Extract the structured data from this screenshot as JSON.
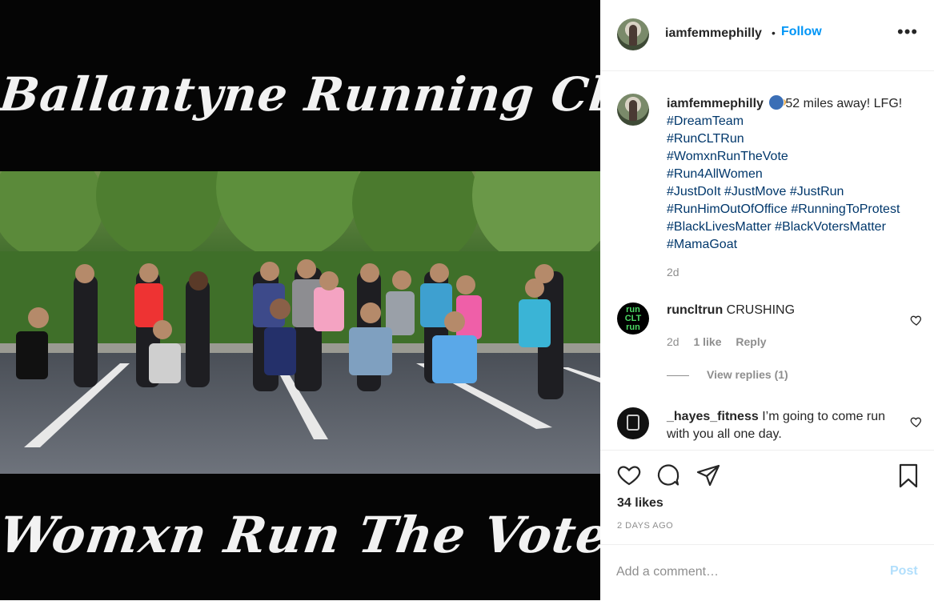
{
  "post_image": {
    "top_text": "Ballantyne Running Club",
    "bottom_text": "Womxn Run The Vote"
  },
  "header": {
    "username": "iamfemmephilly",
    "separator": "•",
    "follow_label": "Follow",
    "more_label": "•••"
  },
  "caption": {
    "username": "iamfemmephilly",
    "text": "52 miles away! LFG!",
    "hashtags": [
      "#DreamTeam",
      "#RunCLTRun",
      "#WomxnRunTheVote",
      "#Run4AllWomen",
      "#JustDoIt #JustMove #JustRun",
      "#RunHimOutOfOffice #RunningToProtest",
      "#BlackLivesMatter #BlackVotersMatter",
      "#MamaGoat"
    ],
    "time": "2d"
  },
  "comments": [
    {
      "username": "runcltrun",
      "avatar_text": [
        "run",
        "CLT",
        "run"
      ],
      "text": "CRUSHING",
      "time": "2d",
      "likes": "1 like",
      "reply_label": "Reply",
      "view_replies": "View replies (1)"
    },
    {
      "username": "_hayes_fitness",
      "text": "I’m going to come run with you all one day."
    }
  ],
  "actions": {
    "likes": "34 likes",
    "date": "2 DAYS AGO"
  },
  "add_comment": {
    "placeholder": "Add a comment…",
    "post_label": "Post"
  },
  "colors": {
    "link": "#0095f6",
    "hashtag": "#00376b",
    "muted": "#8e8e8e",
    "post_disabled": "#b2dffc"
  }
}
